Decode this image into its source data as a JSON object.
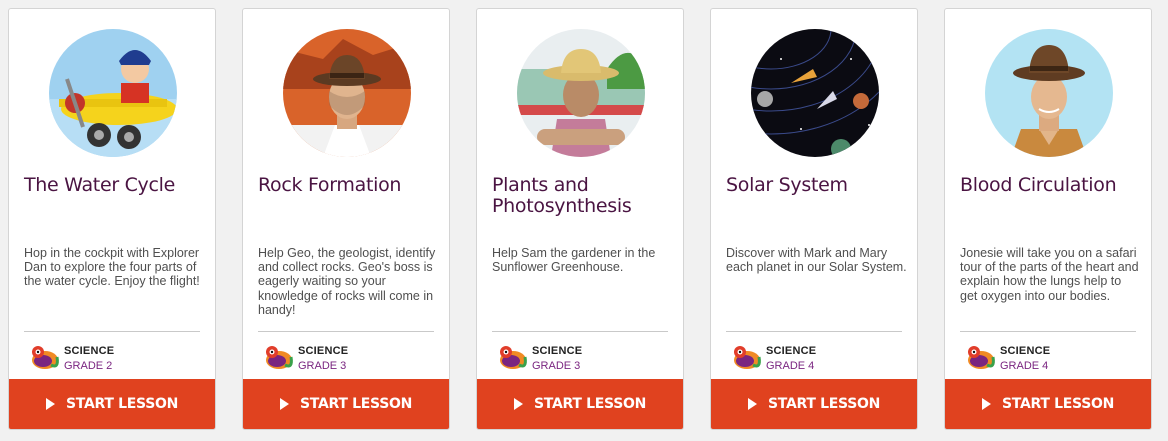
{
  "lessons": [
    {
      "title": "The Water Cycle",
      "description": "Hop in the cockpit with Explorer Dan to explore the four parts of the water cycle. Enjoy the flight!",
      "subject": "SCIENCE",
      "grade": "GRADE 2",
      "button_label": "START LESSON",
      "avatar_icon": "pilot-plane-icon"
    },
    {
      "title": "Rock Formation",
      "description": "Help Geo, the geologist, identify and collect rocks. Geo's boss is eagerly waiting so your knowledge of rocks will come in handy!",
      "subject": "SCIENCE",
      "grade": "GRADE 3",
      "button_label": "START LESSON",
      "avatar_icon": "geologist-icon"
    },
    {
      "title": "Plants and Photosynthesis",
      "description": "Help Sam the gardener in the Sunflower Greenhouse.",
      "subject": "SCIENCE",
      "grade": "GRADE 3",
      "button_label": "START LESSON",
      "avatar_icon": "gardener-icon"
    },
    {
      "title": "Solar System",
      "description": "Discover with Mark and Mary each planet in our Solar System.",
      "subject": "SCIENCE",
      "grade": "GRADE 4",
      "button_label": "START LESSON",
      "avatar_icon": "solar-system-icon"
    },
    {
      "title": "Blood Circulation",
      "description": "Jonesie will take you on a safari tour of the parts of the heart and explain how the lungs help to get oxygen into our bodies.",
      "subject": "SCIENCE",
      "grade": "GRADE 4",
      "button_label": "START LESSON",
      "avatar_icon": "safari-guide-icon"
    }
  ],
  "colors": {
    "button": "#e0421f",
    "title": "#4a1442",
    "grade": "#7a2580"
  }
}
